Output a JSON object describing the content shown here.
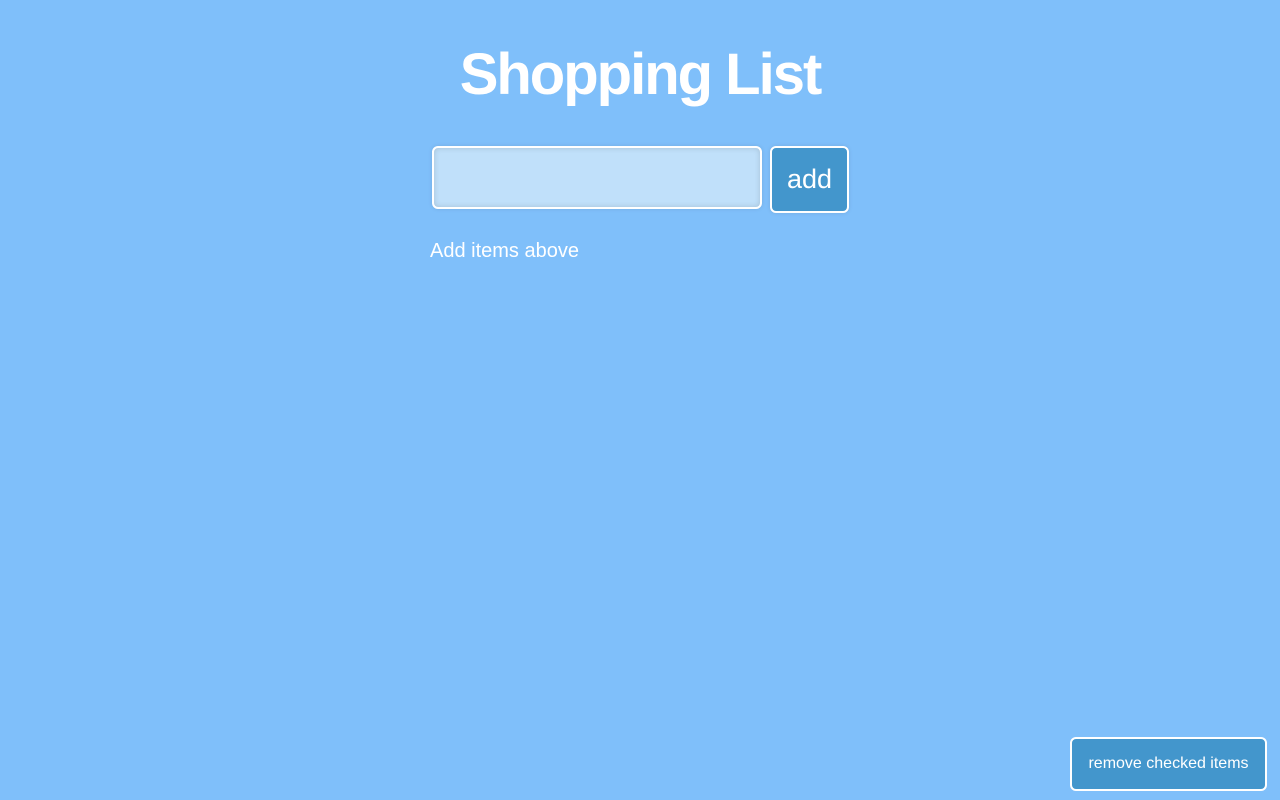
{
  "header": {
    "title": "Shopping List"
  },
  "add_form": {
    "input_value": "",
    "input_placeholder": "",
    "add_label": "add"
  },
  "list": {
    "empty_message": "Add items above",
    "items": []
  },
  "footer": {
    "remove_label": "remove checked items"
  },
  "colors": {
    "background": "#7fbffa",
    "input_fill": "#c0e0fa",
    "button_fill": "#4396cc",
    "text": "#ffffff"
  }
}
